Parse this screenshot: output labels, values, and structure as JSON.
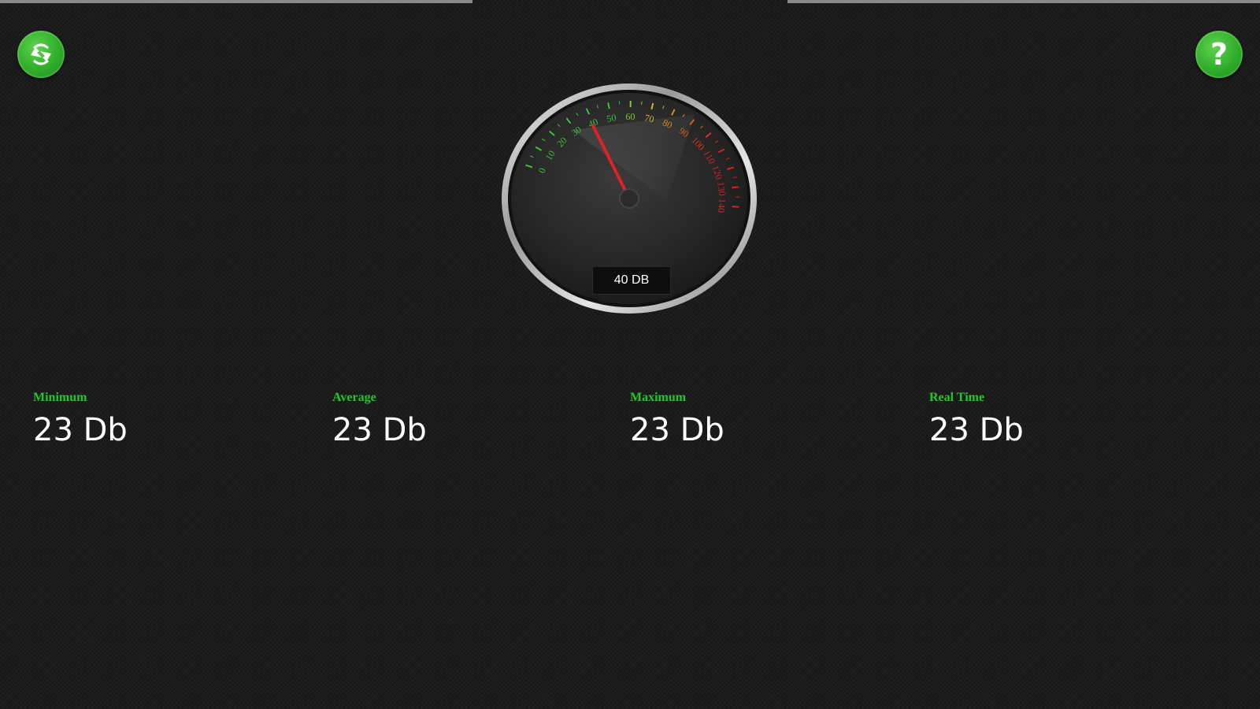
{
  "gauge": {
    "readout": "40 DB",
    "needle_value": 40,
    "scale_min": 0,
    "scale_max": 240,
    "ticks": [
      {
        "label": "0",
        "value": 0,
        "color": "#3fbf3a"
      },
      {
        "label": "10",
        "value": 10,
        "color": "#3fbf3a"
      },
      {
        "label": "20",
        "value": 20,
        "color": "#3fbf3a"
      },
      {
        "label": "30",
        "value": 30,
        "color": "#3fbf3a"
      },
      {
        "label": "40",
        "value": 40,
        "color": "#3fbf3a"
      },
      {
        "label": "50",
        "value": 50,
        "color": "#3fbf3a"
      },
      {
        "label": "60",
        "value": 60,
        "color": "#8fbf30"
      },
      {
        "label": "70",
        "value": 70,
        "color": "#c9b62a"
      },
      {
        "label": "80",
        "value": 80,
        "color": "#d78a22"
      },
      {
        "label": "90",
        "value": 90,
        "color": "#d65a1f"
      },
      {
        "label": "100",
        "value": 100,
        "color": "#d6301f"
      },
      {
        "label": "110",
        "value": 110,
        "color": "#d6201f"
      },
      {
        "label": "120",
        "value": 120,
        "color": "#d6201f"
      },
      {
        "label": "130",
        "value": 130,
        "color": "#d6201f"
      },
      {
        "label": "140",
        "value": 140,
        "color": "#d6201f"
      }
    ],
    "needle_color": "#e0202a"
  },
  "stats": [
    {
      "label": "Minimum",
      "value": "23 Db"
    },
    {
      "label": "Average",
      "value": "23 Db"
    },
    {
      "label": "Maximum",
      "value": "23 Db"
    },
    {
      "label": "Real Time",
      "value": "23 Db"
    }
  ],
  "icons": {
    "refresh": "refresh-icon",
    "help": "help-icon",
    "help_glyph": "?"
  },
  "colors": {
    "accent_green": "#2fae2a",
    "label_green": "#22c82a",
    "background": "#1c1c1c"
  }
}
